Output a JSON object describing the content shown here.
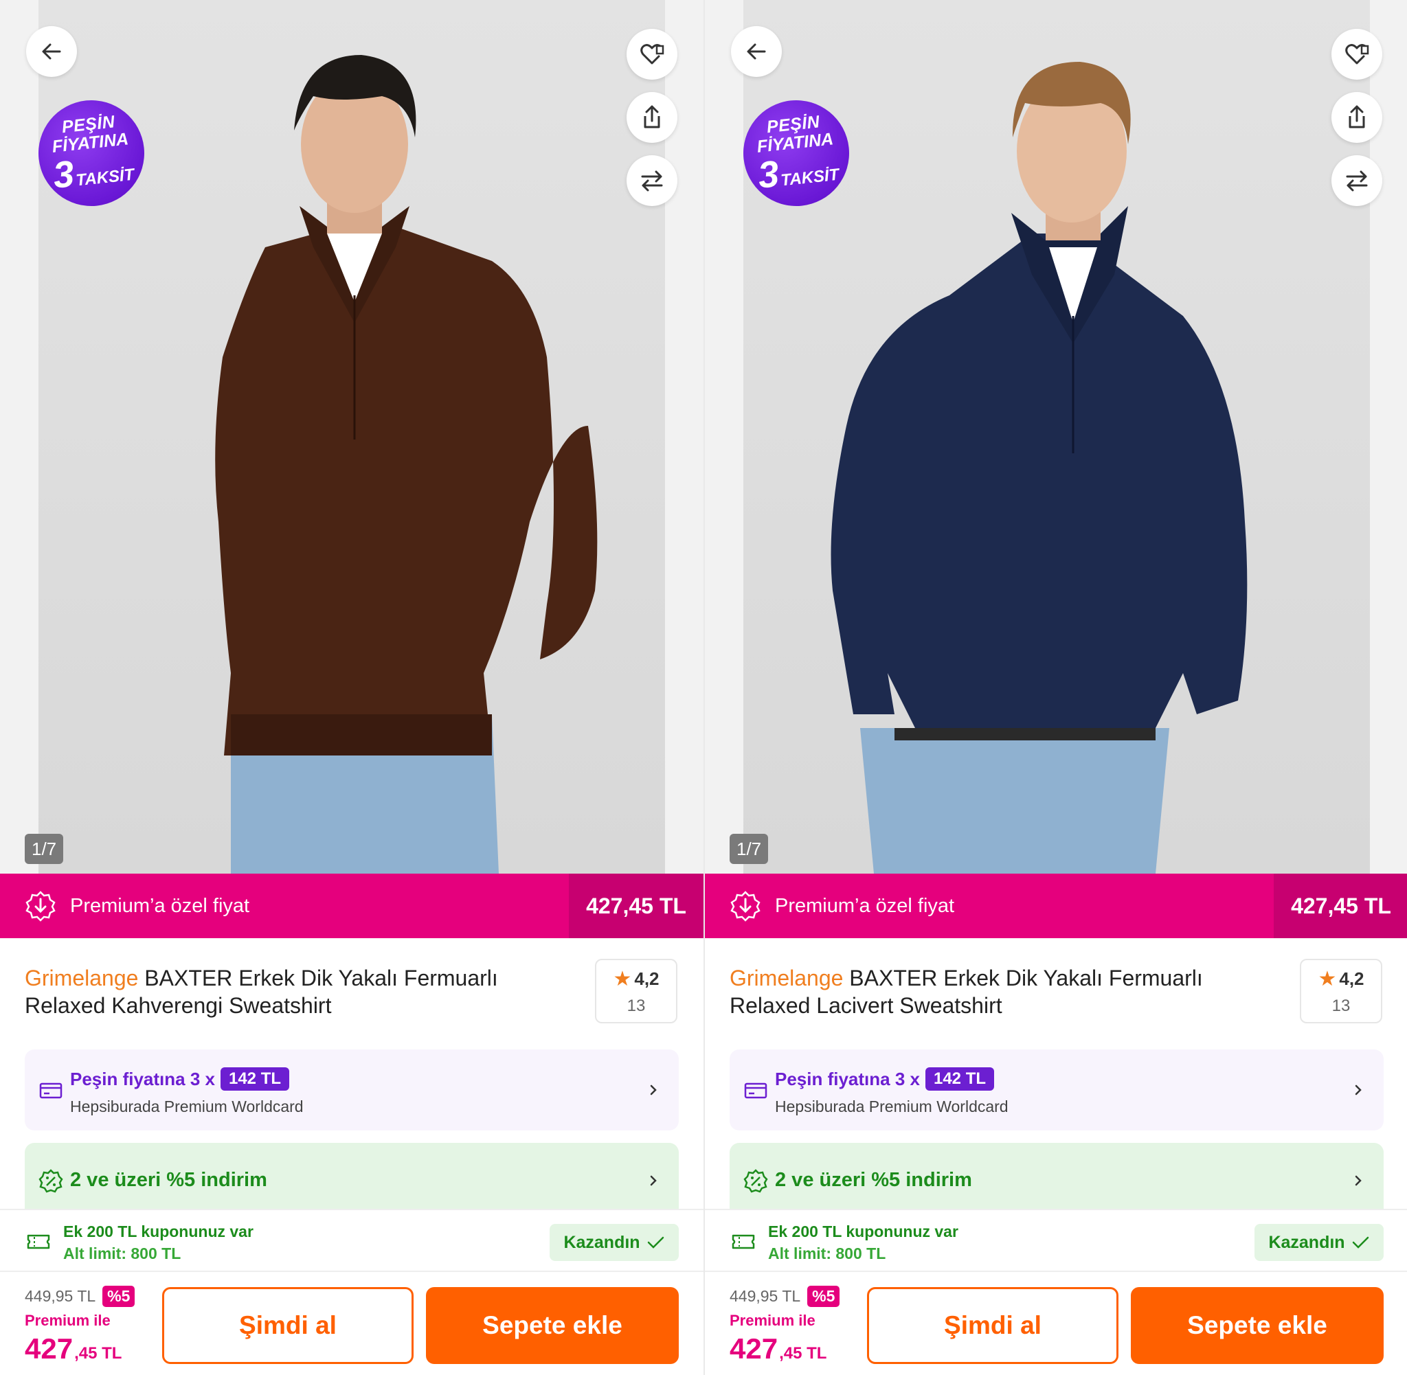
{
  "colors": {
    "premium": "#e5007d",
    "premium_dark": "#c70070",
    "brand": "#f07e1f",
    "action": "#ff6000",
    "purple": "#6c1fd1",
    "green": "#1c8c1c"
  },
  "products": [
    {
      "image_counter": "1/7",
      "sweater_color": "#4a2414",
      "promo_badge": {
        "line1": "PEŞİN",
        "line2": "FİYATINA",
        "number": "3",
        "word": "TAKSİT"
      },
      "premium_bar": {
        "label": "Premium’a özel fiyat",
        "price": "427,45 TL"
      },
      "title": {
        "brand": "Grimelange",
        "name": " BAXTER Erkek Dik Yakalı Fermuarlı Relaxed Kahverengi Sweatshirt"
      },
      "rating": {
        "score": "4,2",
        "count": "13"
      },
      "installment": {
        "text": "Peşin fiyatına 3 x",
        "amount": "142 TL",
        "card": "Hepsiburada Premium Worldcard"
      },
      "discount": {
        "text": "2 ve üzeri %5 indirim"
      },
      "coupon": {
        "line1": "Ek 200 TL kuponunuz var",
        "line2": "Alt limit: 800 TL",
        "badge": "Kazandın"
      },
      "pricing": {
        "old_price": "449,95 TL",
        "discount_pct": "%5",
        "premium_label": "Premium ile",
        "price_int": "427",
        "price_dec": ",45 TL"
      },
      "buttons": {
        "buy_now": "Şimdi al",
        "add_to_cart": "Sepete ekle"
      }
    },
    {
      "image_counter": "1/7",
      "sweater_color": "#1d2a4e",
      "promo_badge": {
        "line1": "PEŞİN",
        "line2": "FİYATINA",
        "number": "3",
        "word": "TAKSİT"
      },
      "premium_bar": {
        "label": "Premium’a özel fiyat",
        "price": "427,45 TL"
      },
      "title": {
        "brand": "Grimelange",
        "name": " BAXTER Erkek Dik Yakalı Fermuarlı Relaxed Lacivert Sweatshirt"
      },
      "rating": {
        "score": "4,2",
        "count": "13"
      },
      "installment": {
        "text": "Peşin fiyatına 3 x",
        "amount": "142 TL",
        "card": "Hepsiburada Premium Worldcard"
      },
      "discount": {
        "text": "2 ve üzeri %5 indirim"
      },
      "coupon": {
        "line1": "Ek 200 TL kuponunuz var",
        "line2": "Alt limit: 800 TL",
        "badge": "Kazandın"
      },
      "pricing": {
        "old_price": "449,95 TL",
        "discount_pct": "%5",
        "premium_label": "Premium ile",
        "price_int": "427",
        "price_dec": ",45 TL"
      },
      "buttons": {
        "buy_now": "Şimdi al",
        "add_to_cart": "Sepete ekle"
      }
    }
  ]
}
